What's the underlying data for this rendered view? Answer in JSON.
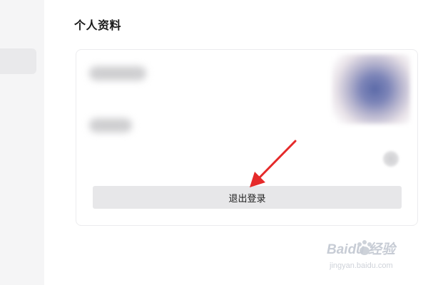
{
  "page": {
    "title": "个人资料"
  },
  "profile_card": {
    "logout_label": "退出登录",
    "avatar": "blurred-avatar-image"
  },
  "colors": {
    "annotation_arrow": "#e52a2a",
    "button_bg": "#e7e7e9",
    "sidebar_bg": "#f5f5f6"
  },
  "watermark": {
    "brand": "Baidu 经验",
    "url": "jingyan.baidu.com"
  }
}
